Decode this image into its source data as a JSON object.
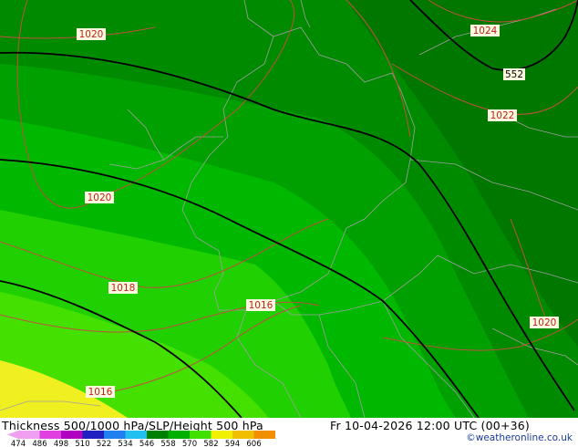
{
  "title": "Thickness 500/1000 hPa/SLP/Height 500 hPa",
  "datetime": "Fr 10-04-2026 12:00 UTC (00+36)",
  "credit": "©weatheronline.co.uk",
  "contour_labels": [
    {
      "text": "1020",
      "kind": "slp"
    },
    {
      "text": "1024",
      "kind": "slp"
    },
    {
      "text": "552",
      "kind": "height"
    },
    {
      "text": "1022",
      "kind": "slp"
    },
    {
      "text": "1020",
      "kind": "slp"
    },
    {
      "text": "1018",
      "kind": "slp"
    },
    {
      "text": "1016",
      "kind": "slp"
    },
    {
      "text": "1020",
      "kind": "slp"
    },
    {
      "text": "1016",
      "kind": "slp"
    }
  ],
  "legend": {
    "ticks": [
      "474",
      "486",
      "498",
      "510",
      "522",
      "534",
      "546",
      "558",
      "570",
      "582",
      "594",
      "606"
    ],
    "colors": [
      "#f0a0f0",
      "#e040e0",
      "#b000c0",
      "#2020c0",
      "#2080f0",
      "#20c0f0",
      "#008000",
      "#00b000",
      "#40e000",
      "#f0f000",
      "#f0c000",
      "#f09000"
    ]
  },
  "colors": {
    "thickness_band_darkest": "#007800",
    "thickness_band_dark": "#008a00",
    "thickness_band_mid": "#00a000",
    "thickness_band_light": "#00b800",
    "thickness_band_lighter": "#20d000",
    "thickness_band_lightest": "#44e000",
    "warm_band": "#f0f020",
    "isobar": "#c05040",
    "height_contour": "#000000",
    "borders": "#a0a0a0"
  }
}
